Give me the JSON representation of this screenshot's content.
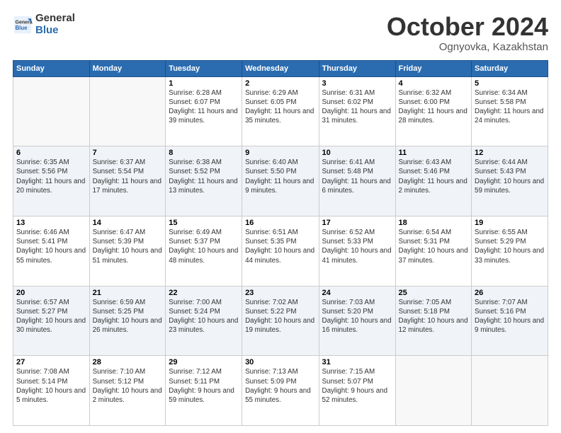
{
  "header": {
    "logo": {
      "general": "General",
      "blue": "Blue"
    },
    "title": "October 2024",
    "location": "Ognyovka, Kazakhstan"
  },
  "columns": [
    "Sunday",
    "Monday",
    "Tuesday",
    "Wednesday",
    "Thursday",
    "Friday",
    "Saturday"
  ],
  "weeks": [
    [
      {
        "day": "",
        "info": ""
      },
      {
        "day": "",
        "info": ""
      },
      {
        "day": "1",
        "info": "Sunrise: 6:28 AM\nSunset: 6:07 PM\nDaylight: 11 hours and 39 minutes."
      },
      {
        "day": "2",
        "info": "Sunrise: 6:29 AM\nSunset: 6:05 PM\nDaylight: 11 hours and 35 minutes."
      },
      {
        "day": "3",
        "info": "Sunrise: 6:31 AM\nSunset: 6:02 PM\nDaylight: 11 hours and 31 minutes."
      },
      {
        "day": "4",
        "info": "Sunrise: 6:32 AM\nSunset: 6:00 PM\nDaylight: 11 hours and 28 minutes."
      },
      {
        "day": "5",
        "info": "Sunrise: 6:34 AM\nSunset: 5:58 PM\nDaylight: 11 hours and 24 minutes."
      }
    ],
    [
      {
        "day": "6",
        "info": "Sunrise: 6:35 AM\nSunset: 5:56 PM\nDaylight: 11 hours and 20 minutes."
      },
      {
        "day": "7",
        "info": "Sunrise: 6:37 AM\nSunset: 5:54 PM\nDaylight: 11 hours and 17 minutes."
      },
      {
        "day": "8",
        "info": "Sunrise: 6:38 AM\nSunset: 5:52 PM\nDaylight: 11 hours and 13 minutes."
      },
      {
        "day": "9",
        "info": "Sunrise: 6:40 AM\nSunset: 5:50 PM\nDaylight: 11 hours and 9 minutes."
      },
      {
        "day": "10",
        "info": "Sunrise: 6:41 AM\nSunset: 5:48 PM\nDaylight: 11 hours and 6 minutes."
      },
      {
        "day": "11",
        "info": "Sunrise: 6:43 AM\nSunset: 5:46 PM\nDaylight: 11 hours and 2 minutes."
      },
      {
        "day": "12",
        "info": "Sunrise: 6:44 AM\nSunset: 5:43 PM\nDaylight: 10 hours and 59 minutes."
      }
    ],
    [
      {
        "day": "13",
        "info": "Sunrise: 6:46 AM\nSunset: 5:41 PM\nDaylight: 10 hours and 55 minutes."
      },
      {
        "day": "14",
        "info": "Sunrise: 6:47 AM\nSunset: 5:39 PM\nDaylight: 10 hours and 51 minutes."
      },
      {
        "day": "15",
        "info": "Sunrise: 6:49 AM\nSunset: 5:37 PM\nDaylight: 10 hours and 48 minutes."
      },
      {
        "day": "16",
        "info": "Sunrise: 6:51 AM\nSunset: 5:35 PM\nDaylight: 10 hours and 44 minutes."
      },
      {
        "day": "17",
        "info": "Sunrise: 6:52 AM\nSunset: 5:33 PM\nDaylight: 10 hours and 41 minutes."
      },
      {
        "day": "18",
        "info": "Sunrise: 6:54 AM\nSunset: 5:31 PM\nDaylight: 10 hours and 37 minutes."
      },
      {
        "day": "19",
        "info": "Sunrise: 6:55 AM\nSunset: 5:29 PM\nDaylight: 10 hours and 33 minutes."
      }
    ],
    [
      {
        "day": "20",
        "info": "Sunrise: 6:57 AM\nSunset: 5:27 PM\nDaylight: 10 hours and 30 minutes."
      },
      {
        "day": "21",
        "info": "Sunrise: 6:59 AM\nSunset: 5:25 PM\nDaylight: 10 hours and 26 minutes."
      },
      {
        "day": "22",
        "info": "Sunrise: 7:00 AM\nSunset: 5:24 PM\nDaylight: 10 hours and 23 minutes."
      },
      {
        "day": "23",
        "info": "Sunrise: 7:02 AM\nSunset: 5:22 PM\nDaylight: 10 hours and 19 minutes."
      },
      {
        "day": "24",
        "info": "Sunrise: 7:03 AM\nSunset: 5:20 PM\nDaylight: 10 hours and 16 minutes."
      },
      {
        "day": "25",
        "info": "Sunrise: 7:05 AM\nSunset: 5:18 PM\nDaylight: 10 hours and 12 minutes."
      },
      {
        "day": "26",
        "info": "Sunrise: 7:07 AM\nSunset: 5:16 PM\nDaylight: 10 hours and 9 minutes."
      }
    ],
    [
      {
        "day": "27",
        "info": "Sunrise: 7:08 AM\nSunset: 5:14 PM\nDaylight: 10 hours and 5 minutes."
      },
      {
        "day": "28",
        "info": "Sunrise: 7:10 AM\nSunset: 5:12 PM\nDaylight: 10 hours and 2 minutes."
      },
      {
        "day": "29",
        "info": "Sunrise: 7:12 AM\nSunset: 5:11 PM\nDaylight: 9 hours and 59 minutes."
      },
      {
        "day": "30",
        "info": "Sunrise: 7:13 AM\nSunset: 5:09 PM\nDaylight: 9 hours and 55 minutes."
      },
      {
        "day": "31",
        "info": "Sunrise: 7:15 AM\nSunset: 5:07 PM\nDaylight: 9 hours and 52 minutes."
      },
      {
        "day": "",
        "info": ""
      },
      {
        "day": "",
        "info": ""
      }
    ]
  ]
}
